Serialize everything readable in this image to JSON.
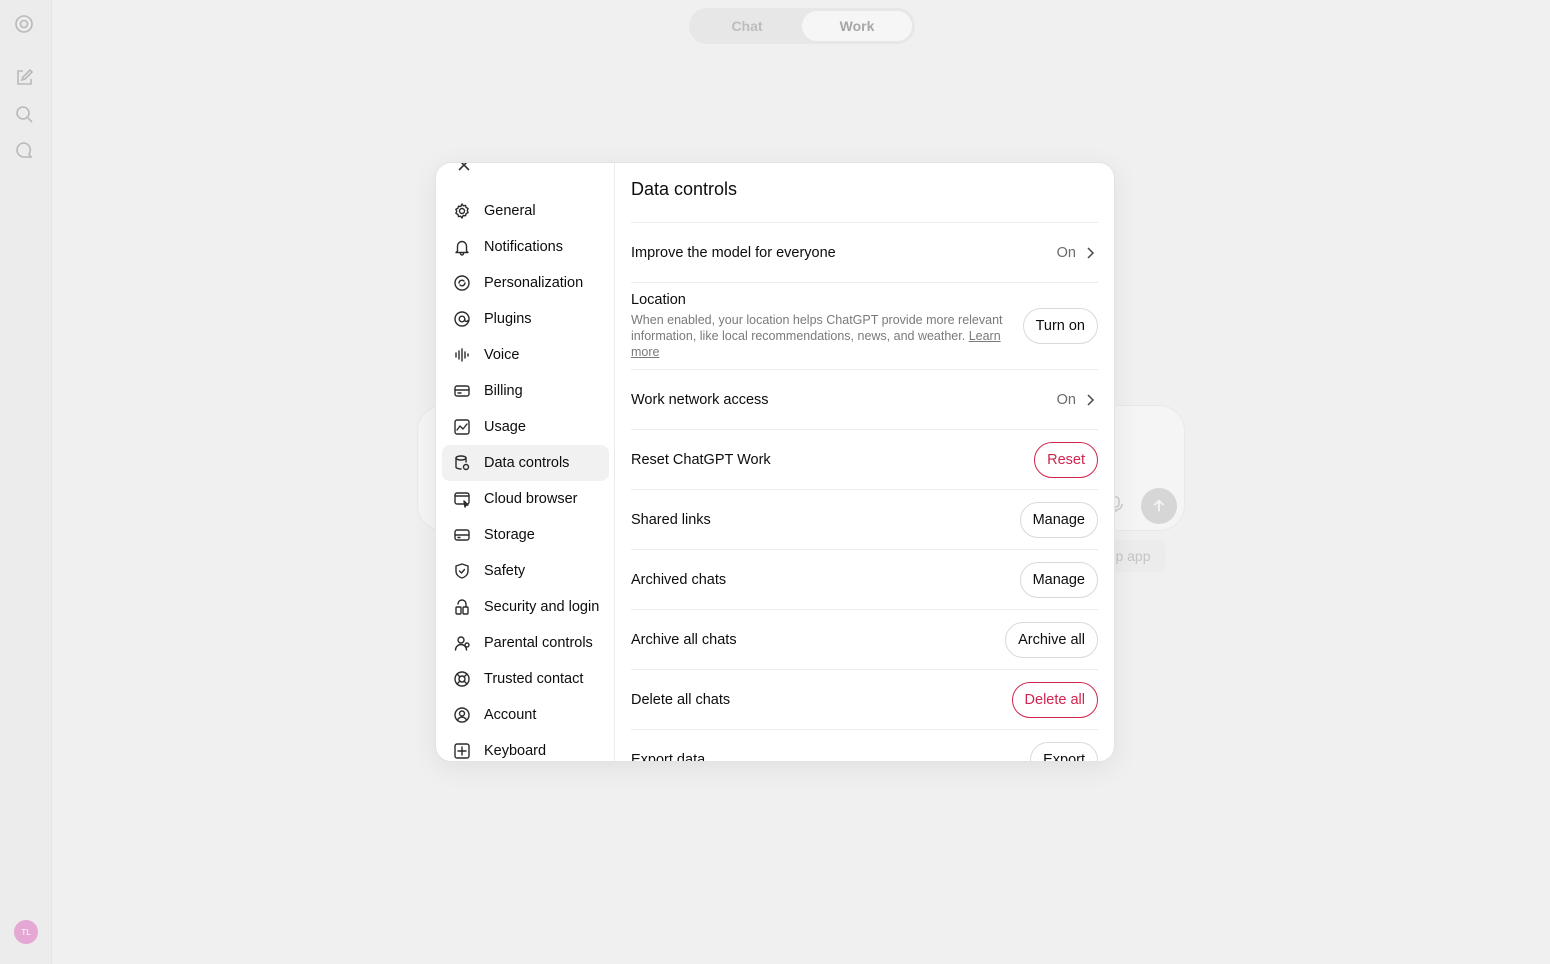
{
  "app": {
    "mode_toggle": {
      "chat_label": "Chat",
      "work_label": "Work"
    },
    "background_pill_label": "p app",
    "avatar_initials": "TL"
  },
  "settings": {
    "nav": [
      {
        "label": "General",
        "icon": "gear-icon"
      },
      {
        "label": "Notifications",
        "icon": "bell-icon"
      },
      {
        "label": "Personalization",
        "icon": "personalization-icon"
      },
      {
        "label": "Plugins",
        "icon": "at-icon"
      },
      {
        "label": "Voice",
        "icon": "waveform-icon"
      },
      {
        "label": "Billing",
        "icon": "card-icon"
      },
      {
        "label": "Usage",
        "icon": "chart-icon"
      },
      {
        "label": "Data controls",
        "icon": "database-icon",
        "active": true
      },
      {
        "label": "Cloud browser",
        "icon": "browser-icon"
      },
      {
        "label": "Storage",
        "icon": "storage-icon"
      },
      {
        "label": "Safety",
        "icon": "shield-icon"
      },
      {
        "label": "Security and login",
        "icon": "lock-icon"
      },
      {
        "label": "Parental controls",
        "icon": "family-icon"
      },
      {
        "label": "Trusted contact",
        "icon": "lifebuoy-icon"
      },
      {
        "label": "Account",
        "icon": "user-circle-icon"
      },
      {
        "label": "Keyboard",
        "icon": "keyboard-icon"
      }
    ],
    "title": "Data controls",
    "rows": {
      "improve": {
        "label": "Improve the model for everyone",
        "value": "On"
      },
      "location": {
        "label": "Location",
        "description": "When enabled, your location helps ChatGPT provide more relevant information, like local recommendations, news, and weather.",
        "learn_more": "Learn more",
        "button": "Turn on"
      },
      "work_network": {
        "label": "Work network access",
        "value": "On"
      },
      "reset": {
        "label": "Reset ChatGPT Work",
        "button": "Reset"
      },
      "shared_links": {
        "label": "Shared links",
        "button": "Manage"
      },
      "archived": {
        "label": "Archived chats",
        "button": "Manage"
      },
      "archive_all": {
        "label": "Archive all chats",
        "button": "Archive all"
      },
      "delete_all": {
        "label": "Delete all chats",
        "button": "Delete all"
      },
      "export": {
        "label": "Export data",
        "button": "Export"
      }
    },
    "colors": {
      "danger": "#d0244c",
      "active_nav_bg": "#f1f1f1"
    }
  }
}
